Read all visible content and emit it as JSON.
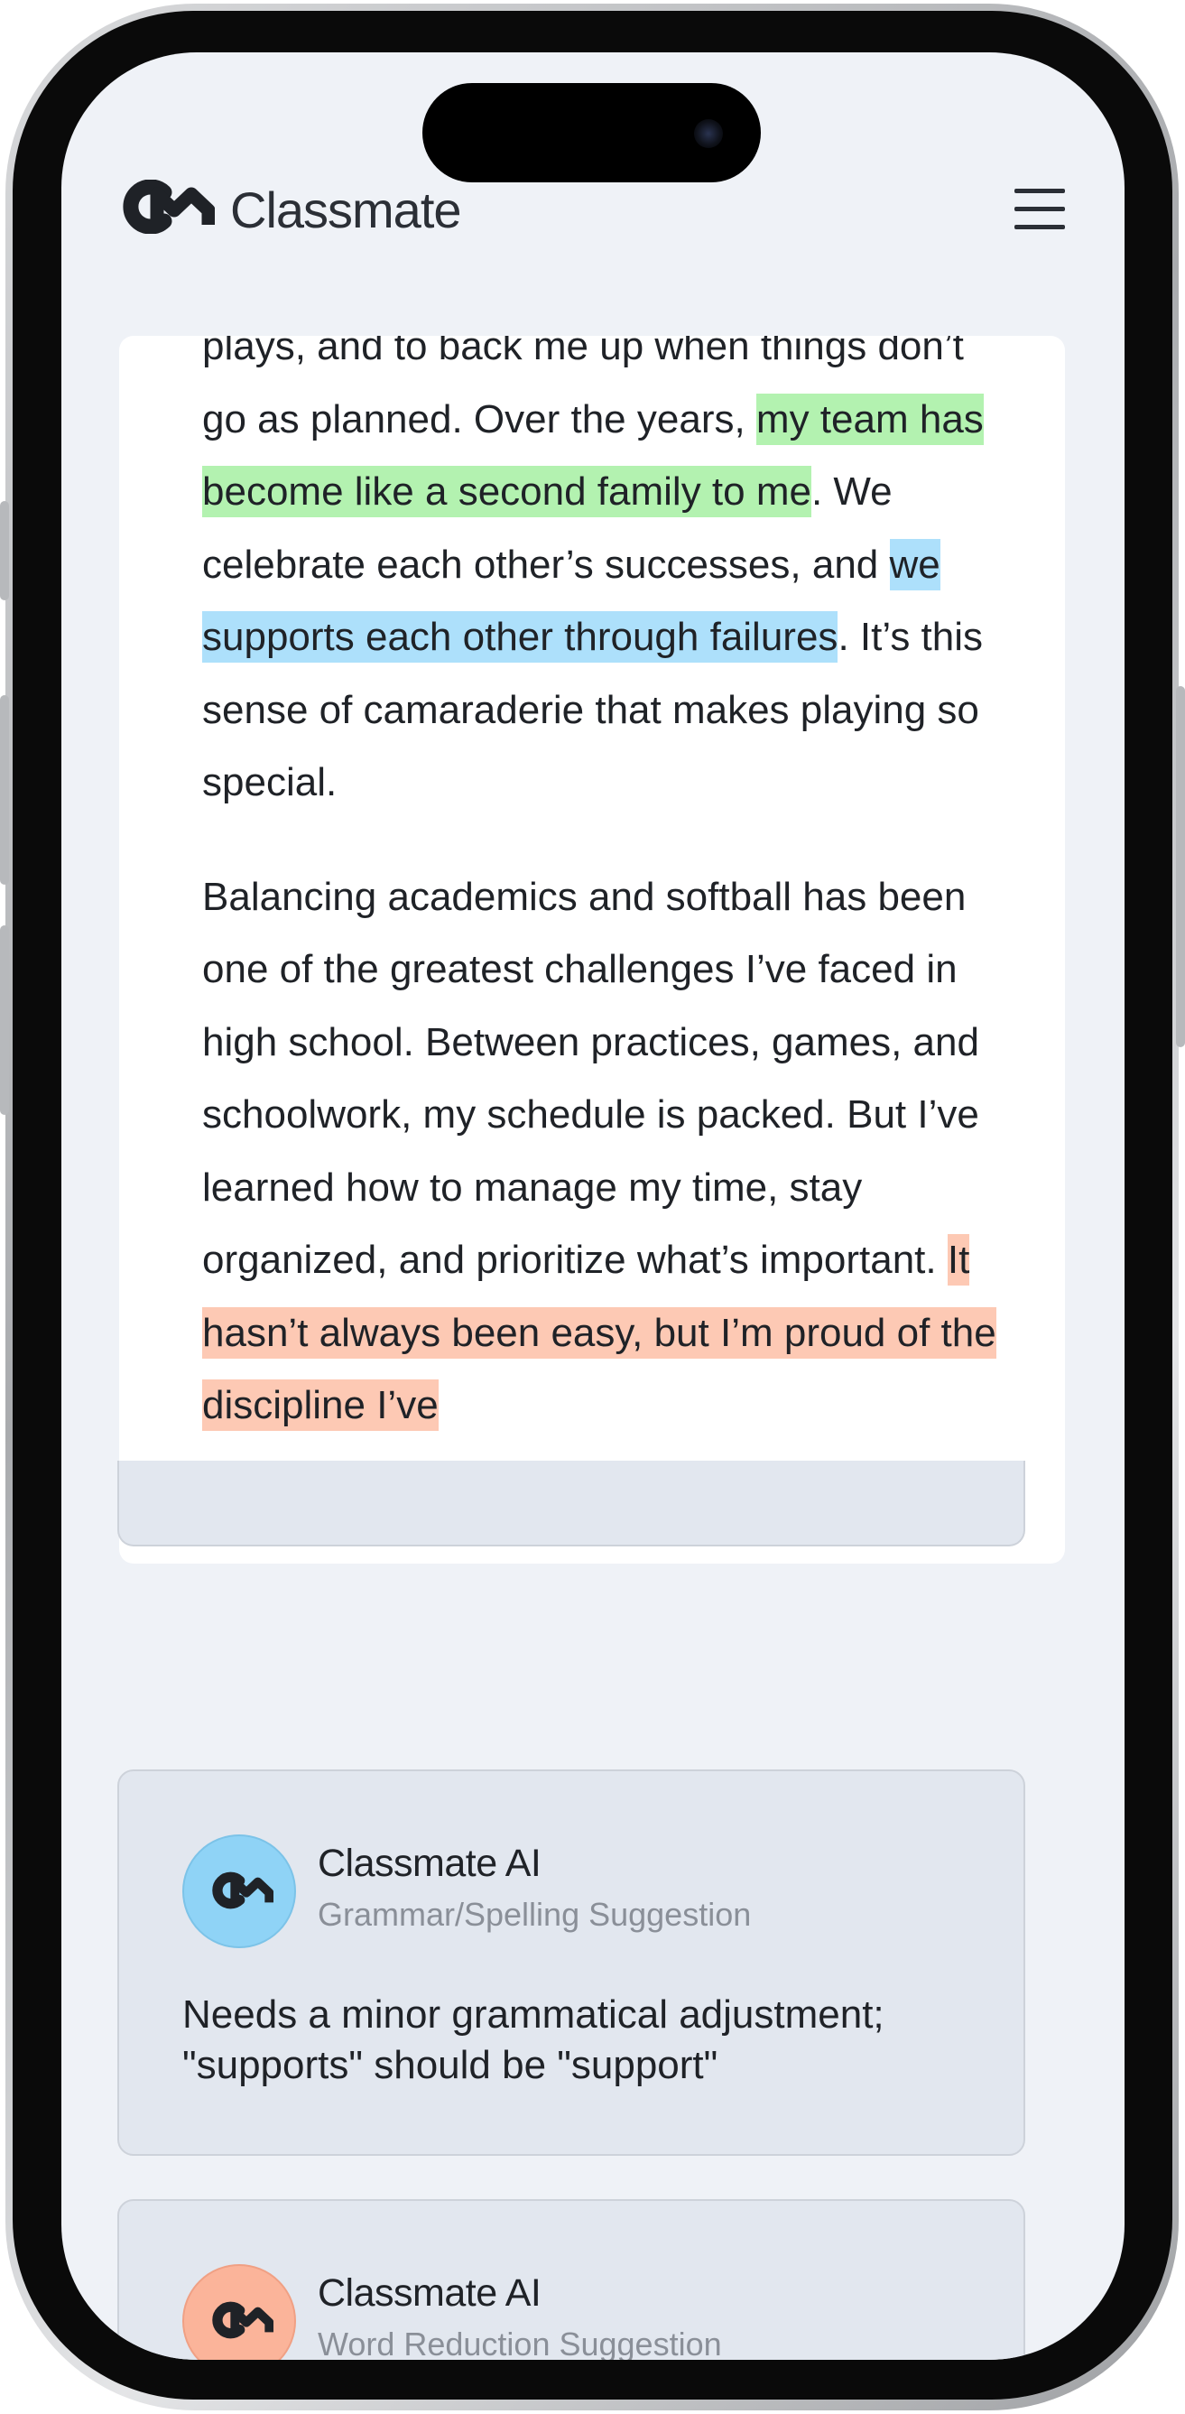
{
  "app": {
    "name": "Classmate",
    "colors": {
      "background": "#eff2f7",
      "card": "#ffffff",
      "suggestion_card": "#e2e7ef"
    },
    "icons": {
      "logo": "classmate-logo-icon",
      "menu": "hamburger-menu-icon"
    }
  },
  "essay": {
    "paragraph1": {
      "t1": "plays, and to back me up when things don’t go as planned. Over the years, ",
      "h1": "my team has become like a second family to me",
      "t2": ". We celebrate each other’s successes, and ",
      "h2": "we supports each other through failures",
      "t3": ". It’s this sense of camaraderie that makes playing so special."
    },
    "paragraph2": {
      "t1": "Balancing academics and softball has been one of the greatest challenges I’ve faced in high school. Between practices, games, and schoolwork, my schedule is packed. But I’ve learned how to manage my time, stay organized, and prioritize what’s important. ",
      "h1": "It hasn’t always been easy, but I’m proud of the discipline I’ve"
    },
    "highlight_colors": {
      "green": "#b3f2b0",
      "blue": "#ade0fb",
      "orange": "#fdc9b4"
    }
  },
  "suggestions": [
    {
      "author": "Classmate AI",
      "type": "Grammar/Spelling Suggestion",
      "text": "Needs a minor grammatical adjustment; \"supports\" should be \"support\"",
      "avatar_color": "#8fd3f6"
    },
    {
      "author": "Classmate AI",
      "type": "Word Reduction Suggestion",
      "text": "",
      "avatar_color": "#fbb49a"
    }
  ]
}
